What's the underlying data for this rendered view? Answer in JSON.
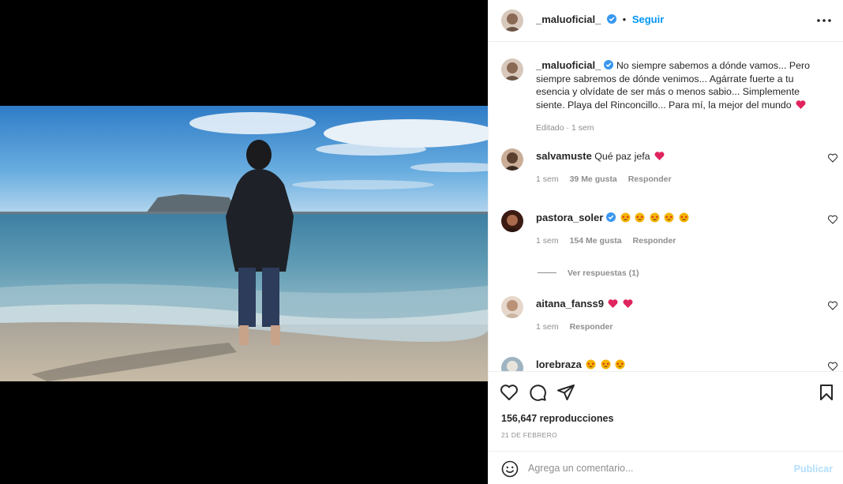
{
  "post": {
    "username": "_maluoficial_",
    "follow_label": "Seguir",
    "separator": "•",
    "caption": "No siempre sabemos a dónde vamos... Pero siempre sabremos de dónde venimos... Agárrate fuerte a tu esencia y olvídate de ser más o menos sabio... Simplemente siente. Playa del Rinconcillo... Para mí, la mejor del mundo",
    "caption_meta": "Editado · 1 sem",
    "views": "156,647 reproducciones",
    "date": "21 DE FEBRERO"
  },
  "comments": [
    {
      "username": "salvamuste",
      "text": "Qué paz jefa",
      "time": "1 sem",
      "likes": "39 Me gusta",
      "reply": "Responder",
      "emojis": [
        "heart"
      ]
    },
    {
      "username": "pastora_soler",
      "text": "",
      "time": "1 sem",
      "likes": "154 Me gusta",
      "reply": "Responder",
      "emojis": [
        "star-eyes",
        "star-eyes",
        "star-eyes",
        "star-eyes",
        "star-eyes"
      ]
    },
    {
      "username": "aitana_fanss9",
      "text": "",
      "time": "1 sem",
      "reply": "Responder",
      "emojis": [
        "heart",
        "heart"
      ]
    },
    {
      "username": "lorebraza",
      "text": "",
      "emojis": [
        "star-eyes",
        "star-eyes",
        "star-eyes"
      ]
    }
  ],
  "view_replies": "Ver respuestas (1)",
  "add_comment": {
    "placeholder": "Agrega un comentario...",
    "publish_label": "Publicar"
  },
  "icons": [
    "more-icon",
    "verified-icon",
    "heart-icon",
    "comment-icon",
    "share-icon",
    "bookmark-icon",
    "smile-icon"
  ],
  "colors": {
    "accent": "#0095f6",
    "heart": "#ed4956",
    "muted": "#8e8e8e",
    "publish_disabled": "#b2dffc"
  }
}
